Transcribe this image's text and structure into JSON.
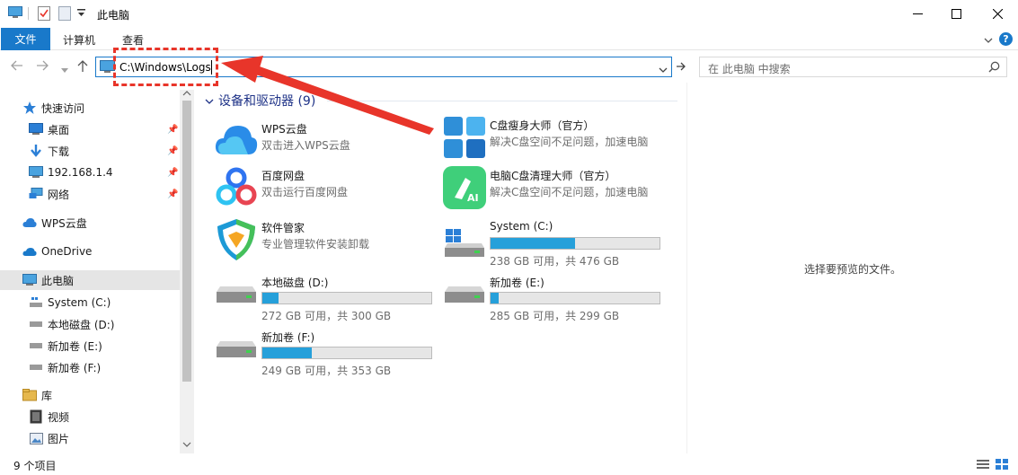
{
  "window": {
    "title": "此电脑"
  },
  "ribbon": {
    "tabs": [
      {
        "label": "文件",
        "active": true
      },
      {
        "label": "计算机"
      },
      {
        "label": "查看"
      }
    ],
    "help_label": "?"
  },
  "address": {
    "path": "C:\\Windows\\Logs",
    "search_placeholder": "在 此电脑 中搜索"
  },
  "sidebar": {
    "items": [
      {
        "label": "快速访问",
        "icon": "star-icon"
      },
      {
        "label": "桌面",
        "icon": "desktop-icon",
        "pinned": true
      },
      {
        "label": "下载",
        "icon": "download-icon",
        "pinned": true
      },
      {
        "label": "192.168.1.4",
        "icon": "computer-icon",
        "pinned": true
      },
      {
        "label": "网络",
        "icon": "network-icon",
        "pinned": true
      },
      {
        "label": "WPS云盘",
        "icon": "cloud-icon"
      },
      {
        "label": "OneDrive",
        "icon": "onedrive-icon"
      },
      {
        "label": "此电脑",
        "icon": "computer-icon",
        "selected": true
      },
      {
        "label": "System (C:)",
        "icon": "drive-icon"
      },
      {
        "label": "本地磁盘 (D:)",
        "icon": "drive-icon"
      },
      {
        "label": "新加卷 (E:)",
        "icon": "drive-icon"
      },
      {
        "label": "新加卷 (F:)",
        "icon": "drive-icon"
      },
      {
        "label": "库",
        "icon": "library-icon"
      },
      {
        "label": "视频",
        "icon": "video-icon"
      },
      {
        "label": "图片",
        "icon": "picture-icon"
      }
    ]
  },
  "main": {
    "group_header": "设备和驱动器 (9)",
    "apps": [
      {
        "name": "WPS云盘",
        "desc": "双击进入WPS云盘",
        "icon": "wps-cloud-icon"
      },
      {
        "name": "C盘瘦身大师（官方）",
        "desc": "解决C盘空间不足问题，加速电脑",
        "icon": "c-slim-icon"
      },
      {
        "name": "百度网盘",
        "desc": "双击运行百度网盘",
        "icon": "baidu-netdisk-icon"
      },
      {
        "name": "电脑C盘清理大师（官方）",
        "desc": "解决C盘空间不足问题，加速电脑",
        "icon": "c-cleaner-icon"
      },
      {
        "name": "软件管家",
        "desc": "专业管理软件安装卸载",
        "icon": "software-manager-icon"
      }
    ],
    "drives": [
      {
        "name": "System (C:)",
        "desc": "238 GB 可用，共 476 GB",
        "used_fraction": 0.5
      },
      {
        "name": "本地磁盘 (D:)",
        "desc": "272 GB 可用，共 300 GB",
        "used_fraction": 0.0933
      },
      {
        "name": "新加卷 (E:)",
        "desc": "285 GB 可用，共 299 GB",
        "used_fraction": 0.0468
      },
      {
        "name": "新加卷 (F:)",
        "desc": "249 GB 可用，共 353 GB",
        "used_fraction": 0.2946
      }
    ]
  },
  "preview": {
    "message": "选择要预览的文件。"
  },
  "status": {
    "count": "9 个项目"
  },
  "colors": {
    "accent": "#1979ca",
    "drive_fill": "#26a0da",
    "annotation": "#e8352a"
  }
}
